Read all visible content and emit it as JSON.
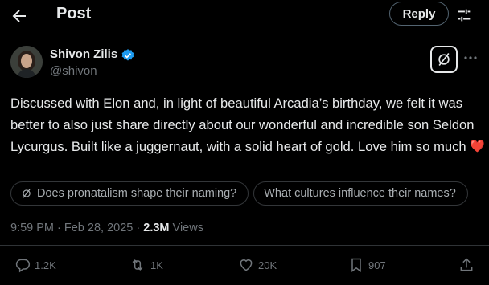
{
  "header": {
    "title": "Post",
    "reply_label": "Reply"
  },
  "author": {
    "name": "Shivon Zilis",
    "handle": "@shivon"
  },
  "post": {
    "text": "Discussed with Elon and, in light of beautiful Arcadia’s birthday, we felt it was better to also just share directly about our wonderful and incredible son Seldon Lycurgus. Built like a juggernaut, with a solid heart of gold. Love him so much",
    "emoji": "❤️"
  },
  "grok_suggestions": [
    "Does pronatalism shape their naming?",
    "What cultures influence their names?"
  ],
  "meta": {
    "time": "9:59 PM",
    "date": "Feb 28, 2025",
    "views_count": "2.3M",
    "views_label": "Views"
  },
  "stats": {
    "replies": "1.2K",
    "reposts": "1K",
    "likes": "20K",
    "bookmarks": "907"
  },
  "colors": {
    "background": "#000000",
    "text": "#e7e9ea",
    "muted": "#71767b",
    "verified": "#1d9bf0",
    "heart": "#e0245e"
  },
  "icons": {
    "back": "arrow-left-icon",
    "tune": "sliders-icon",
    "verified": "verified-badge-icon",
    "grok": "grok-icon",
    "more": "more-horizontal-icon",
    "reply": "reply-icon",
    "repost": "repost-icon",
    "like": "heart-icon",
    "bookmark": "bookmark-icon",
    "share": "share-icon"
  }
}
